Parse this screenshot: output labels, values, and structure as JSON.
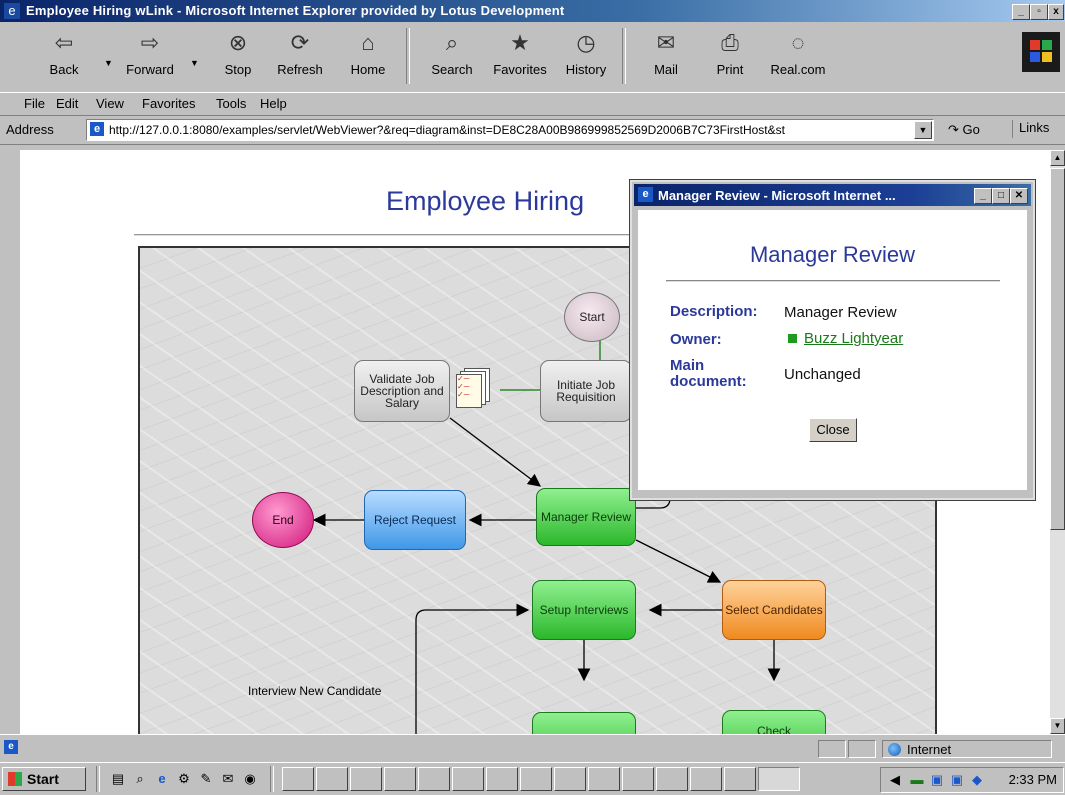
{
  "window": {
    "title": "Employee Hiring wLink - Microsoft Internet Explorer provided by Lotus Development",
    "controls": [
      "_",
      "▫",
      "x"
    ]
  },
  "toolbar": {
    "buttons": [
      {
        "label": "Back",
        "icon": "back-arrow-icon"
      },
      {
        "label": "Forward",
        "icon": "forward-arrow-icon"
      },
      {
        "label": "Stop",
        "icon": "stop-icon"
      },
      {
        "label": "Refresh",
        "icon": "refresh-icon"
      },
      {
        "label": "Home",
        "icon": "home-icon"
      },
      {
        "label": "Search",
        "icon": "search-icon"
      },
      {
        "label": "Favorites",
        "icon": "favorites-icon"
      },
      {
        "label": "History",
        "icon": "history-icon"
      },
      {
        "label": "Mail",
        "icon": "mail-icon"
      },
      {
        "label": "Print",
        "icon": "print-icon"
      },
      {
        "label": "Real.com",
        "icon": "realcom-icon"
      }
    ]
  },
  "menu": {
    "items": [
      "File",
      "Edit",
      "View",
      "Favorites",
      "Tools",
      "Help"
    ]
  },
  "address": {
    "label": "Address",
    "url": "http://127.0.0.1:8080/examples/servlet/WebViewer?&req=diagram&inst=DE8C28A00B986999852569D2006B7C73FirstHost&st",
    "go": "Go",
    "links": "Links"
  },
  "page": {
    "heading": "Employee Hiring",
    "nodes": {
      "start": "Start",
      "validate": "Validate Job Description and Salary",
      "initiate": "Initiate Job Requisition",
      "manager_review": "Manager Review",
      "reject": "Reject Request",
      "end": "End",
      "select": "Select Candidates",
      "setup": "Setup Interviews",
      "check": "Check"
    },
    "edge_label": "Interview New Candidate"
  },
  "popup": {
    "title": "Manager Review - Microsoft Internet ...",
    "heading": "Manager Review",
    "description_label": "Description:",
    "description_value": "Manager Review",
    "owner_label": "Owner:",
    "owner_value": "Buzz Lightyear",
    "main_doc_label": "Main document:",
    "main_doc_value": "Unchanged",
    "close_label": "Close"
  },
  "status": {
    "zone": "Internet"
  },
  "taskbar": {
    "start": "Start",
    "clock": "2:33 PM"
  }
}
